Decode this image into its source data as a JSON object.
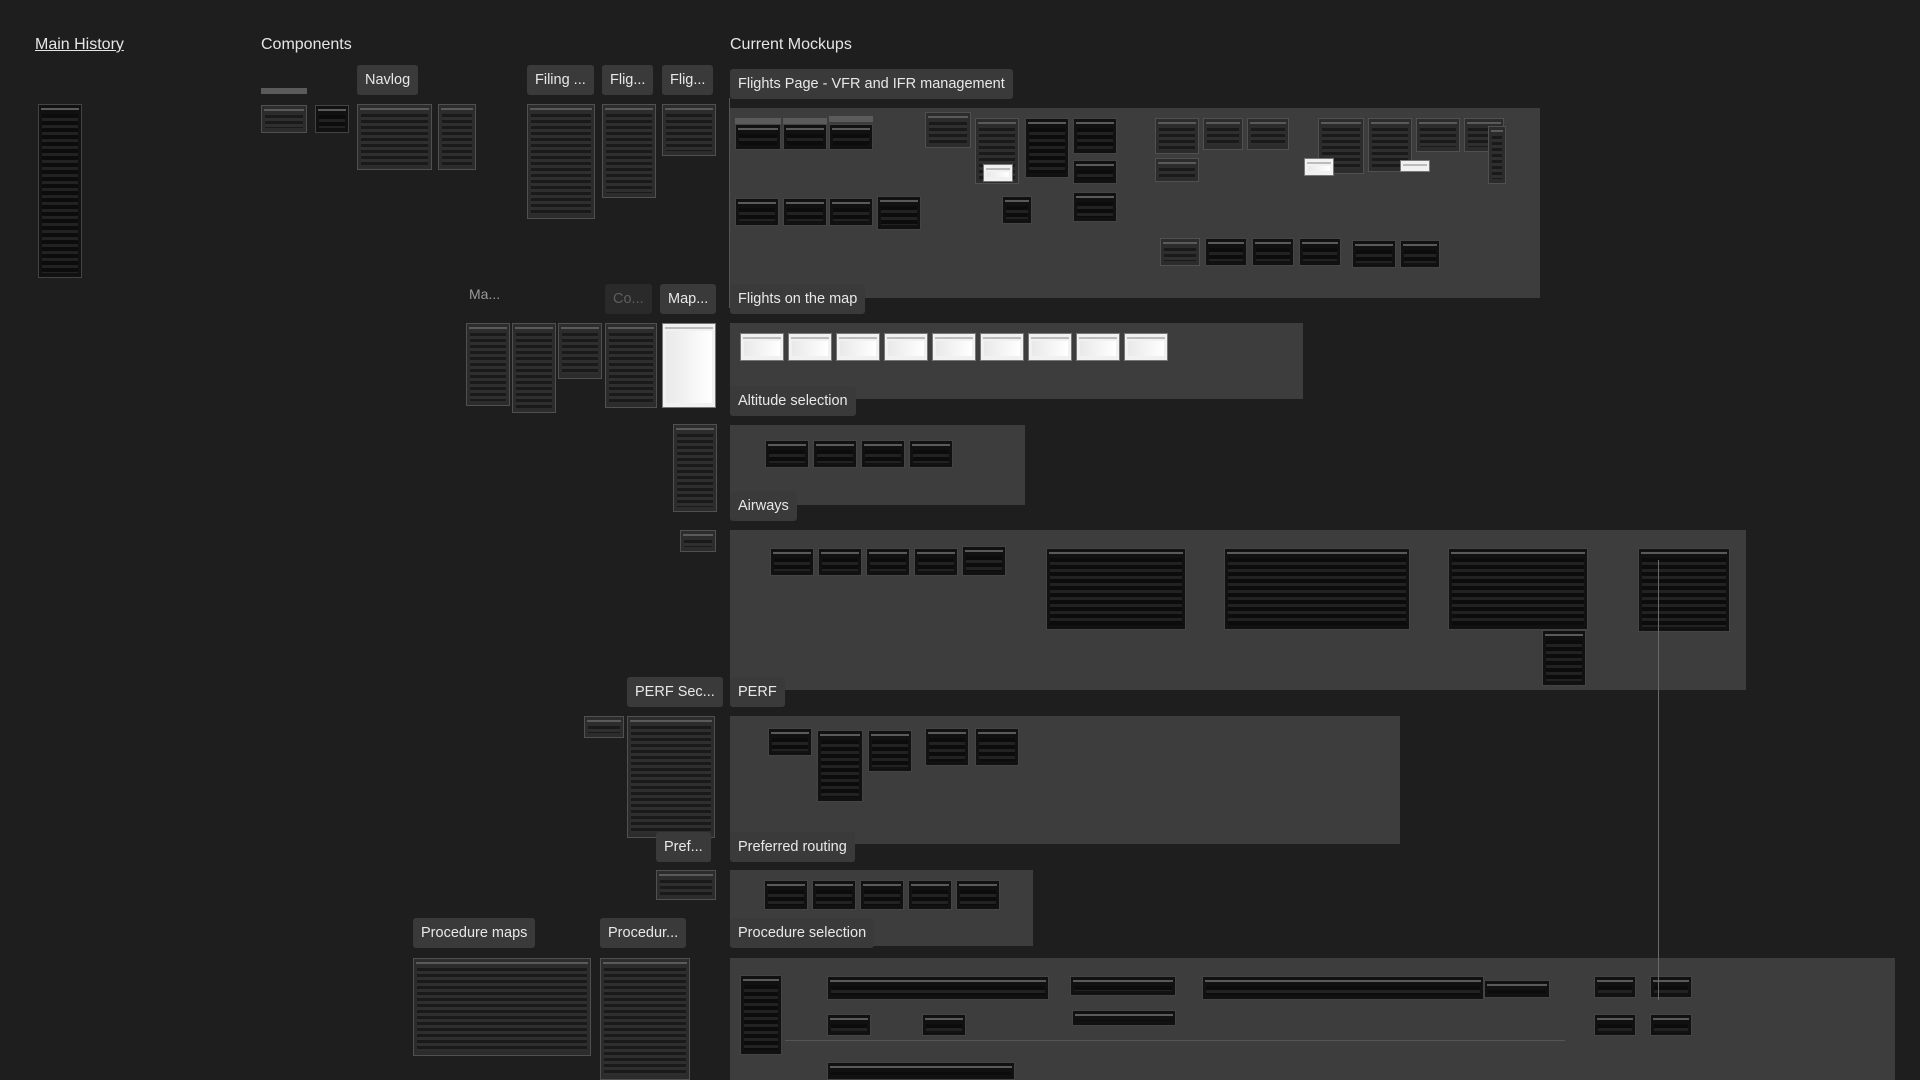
{
  "headings": {
    "main_history": "Main History",
    "components": "Components",
    "current_mockups": "Current Mockups"
  },
  "component_pills": {
    "navlog": "Navlog",
    "filing1": "Filing ...",
    "filing2": "Flig...",
    "filing3": "Flig...",
    "map_group": "Ma...",
    "co_group": "Co...",
    "map_pill": "Map...",
    "perf_sec": "PERF Sec...",
    "pref": "Pref...",
    "procedure_maps": "Procedure maps",
    "procedure_short": "Procedur..."
  },
  "sections": [
    {
      "id": "flights-page",
      "label": "Flights Page - VFR and IFR management"
    },
    {
      "id": "flights-on-map",
      "label": "Flights on the map"
    },
    {
      "id": "altitude-selection",
      "label": "Altitude selection"
    },
    {
      "id": "airways",
      "label": "Airways"
    },
    {
      "id": "perf",
      "label": "PERF"
    },
    {
      "id": "preferred-routing",
      "label": "Preferred routing"
    },
    {
      "id": "procedure-selection",
      "label": "Procedure selection"
    }
  ],
  "colors": {
    "canvas": "#1e1e1e",
    "section": "#3d3d3d",
    "pill": "#3a3a3a",
    "text": "#e6e6e6"
  }
}
